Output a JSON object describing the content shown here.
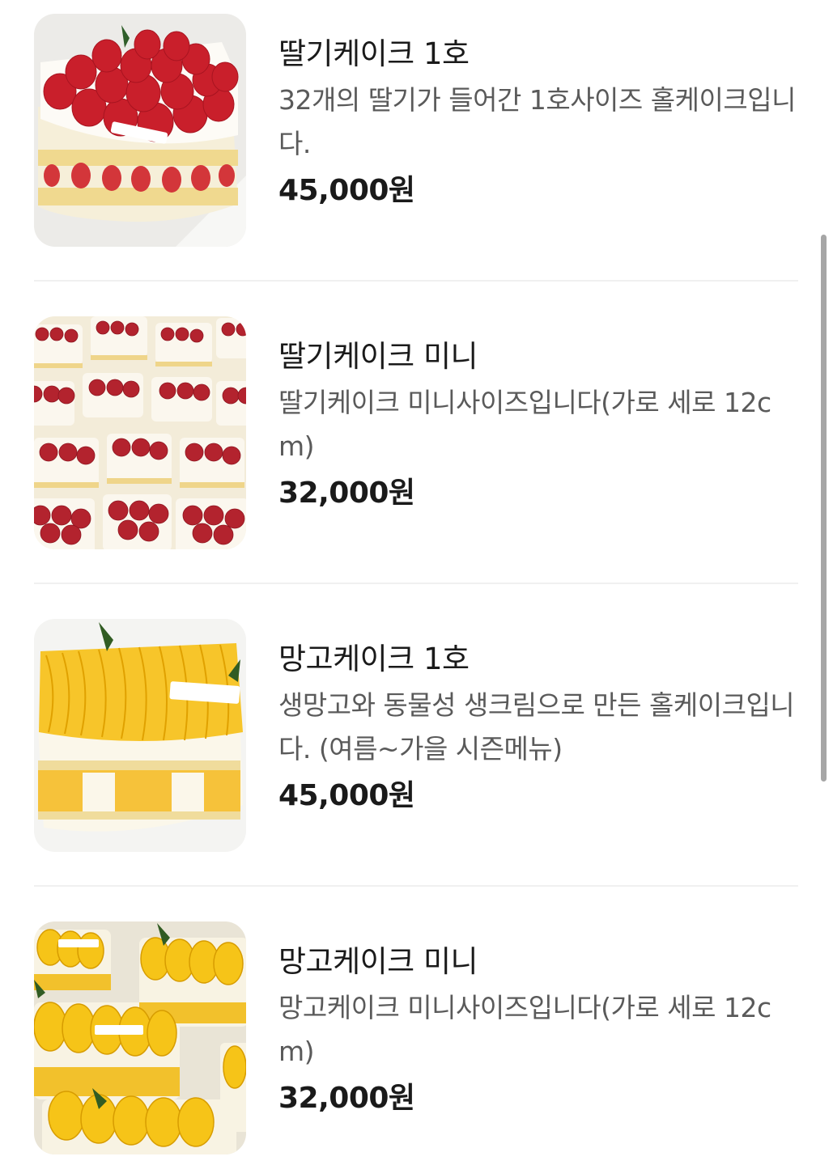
{
  "menu": {
    "items": [
      {
        "name": "딸기케이크 1호",
        "description": "32개의 딸기가 들어간 1호사이즈 홀케이크입니다.",
        "price": "45,000원",
        "image": "strawberry-whole-cake"
      },
      {
        "name": "딸기케이크 미니",
        "description": "딸기케이크 미니사이즈입니다(가로 세로 12cm)",
        "price": "32,000원",
        "image": "strawberry-mini-cakes"
      },
      {
        "name": "망고케이크 1호",
        "description": "생망고와 동물성 생크림으로 만든 홀케이크입니다. (여름~가을 시즌메뉴)",
        "price": "45,000원",
        "image": "mango-whole-cake"
      },
      {
        "name": "망고케이크 미니",
        "description": "망고케이크 미니사이즈입니다(가로 세로 12cm)",
        "price": "32,000원",
        "image": "mango-mini-cakes"
      }
    ]
  },
  "colors": {
    "strawberry": "#d62a35",
    "mango": "#f5b800",
    "cream": "#fbf6ea",
    "sponge": "#f1d894"
  }
}
